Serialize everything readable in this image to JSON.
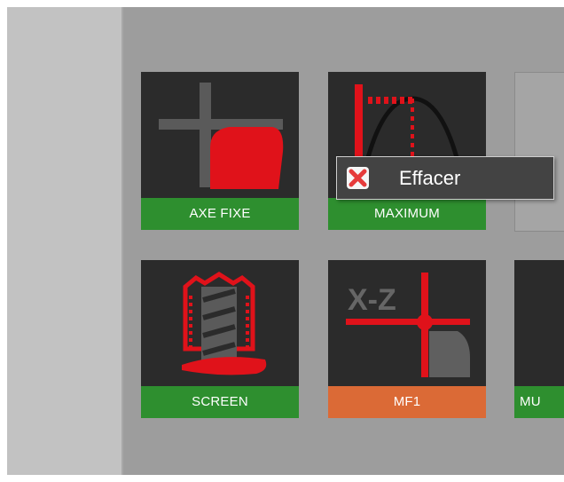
{
  "tiles": [
    {
      "label": "AXE FIXE",
      "label_color": "#2e8f2f",
      "icon": "fixed-axis-icon"
    },
    {
      "label": "MAXIMUM",
      "label_color": "#2e8f2f",
      "icon": "maximum-curve-icon"
    },
    {
      "label": "SCREEN",
      "label_color": "#2e8f2f",
      "icon": "screen-drill-icon"
    },
    {
      "label": "MF1",
      "label_color": "#db6a36",
      "icon": "xz-crosshair-icon"
    },
    {
      "label": "MU",
      "label_color": "#2e8f2f",
      "icon": ""
    }
  ],
  "context_menu": {
    "item_label": "Effacer",
    "item_icon": "delete-x-icon"
  },
  "colors": {
    "accent_red": "#e0121a",
    "tile_background": "#2b2b2b",
    "workspace_background": "#9d9d9d",
    "menu_background": "#434343"
  }
}
